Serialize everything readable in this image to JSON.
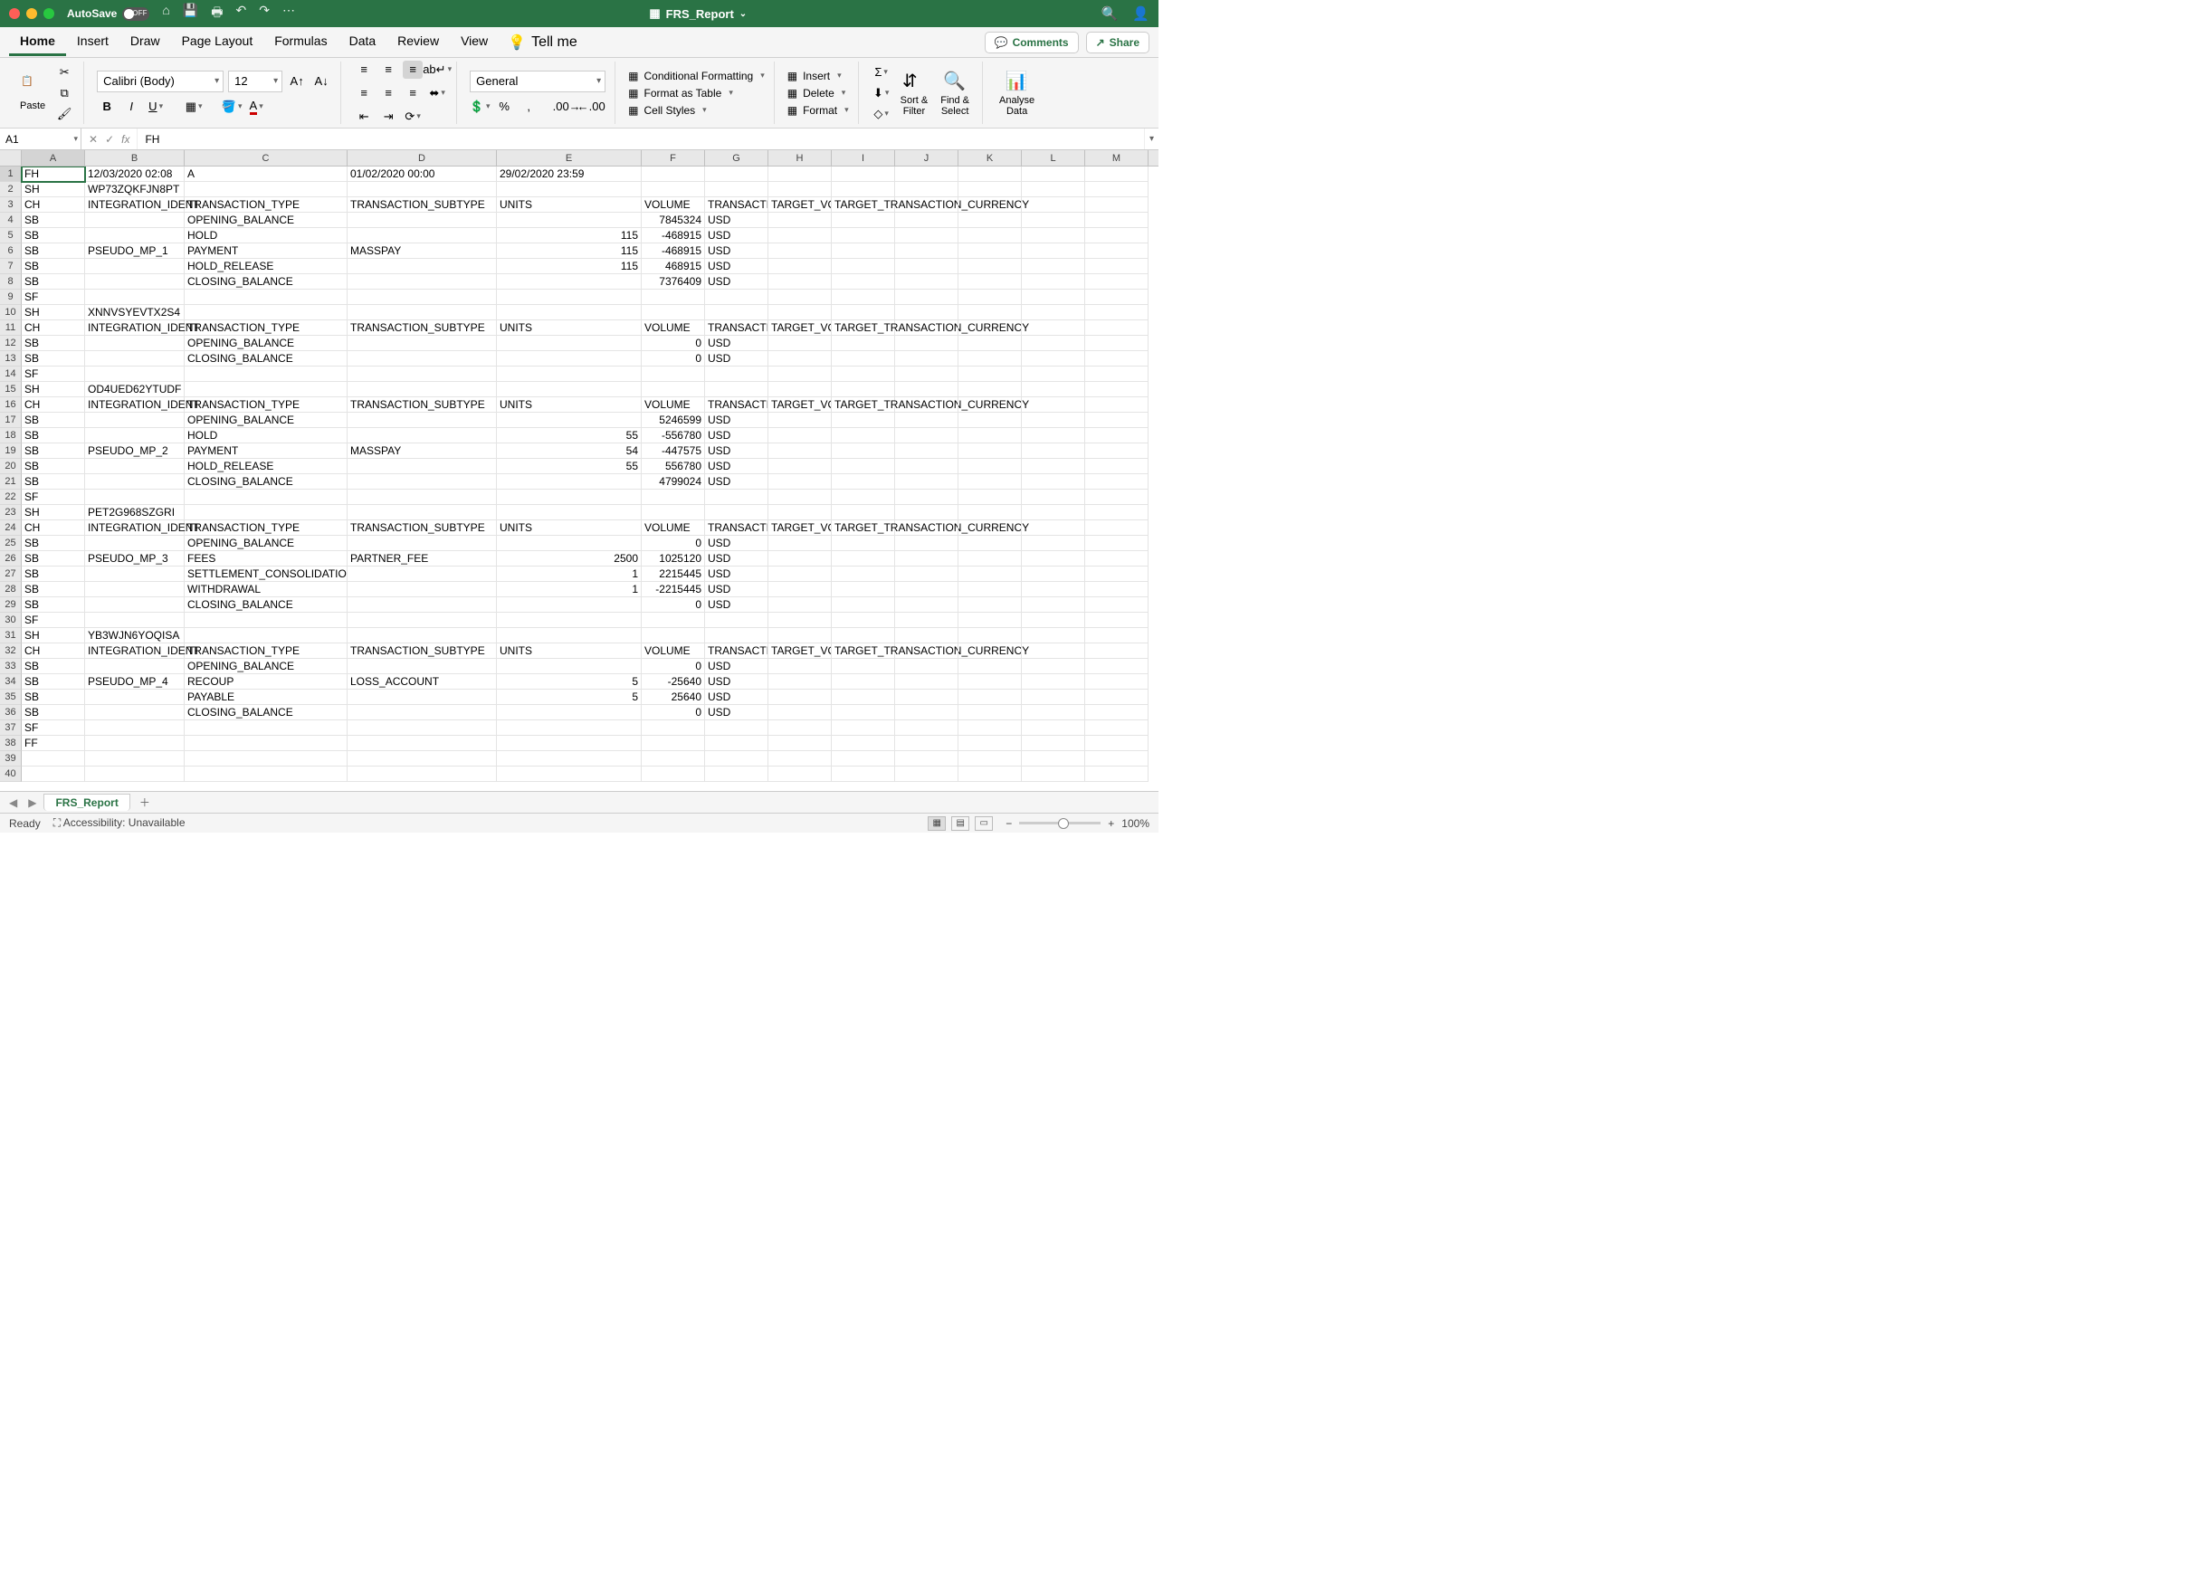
{
  "titlebar": {
    "autosave_label": "AutoSave",
    "autosave_state": "OFF",
    "filename": "FRS_Report"
  },
  "ribbon_tabs": [
    "Home",
    "Insert",
    "Draw",
    "Page Layout",
    "Formulas",
    "Data",
    "Review",
    "View"
  ],
  "tellme": "Tell me",
  "comments_btn": "Comments",
  "share_btn": "Share",
  "ribbon": {
    "paste": "Paste",
    "font_name": "Calibri (Body)",
    "font_size": "12",
    "number_format": "General",
    "cond_fmt": "Conditional Formatting",
    "fmt_table": "Format as Table",
    "cell_styles": "Cell Styles",
    "insert": "Insert",
    "delete": "Delete",
    "format": "Format",
    "sort_filter": "Sort &\nFilter",
    "find_select": "Find &\nSelect",
    "analyse": "Analyse\nData"
  },
  "namebox": "A1",
  "formula": "FH",
  "columns": [
    "A",
    "B",
    "C",
    "D",
    "E",
    "F",
    "G",
    "H",
    "I",
    "J",
    "K",
    "L",
    "M"
  ],
  "col_classes": [
    "cA",
    "cB",
    "cC",
    "cD",
    "cE",
    "cF",
    "cG",
    "cH",
    "cI",
    "cJ",
    "cK",
    "cL",
    "cM"
  ],
  "num_cols": {
    "B": false,
    "E": true,
    "F": true,
    "G": true
  },
  "rows": [
    {
      "n": 1,
      "A": "FH",
      "B": "12/03/2020 02:08",
      "C": "A",
      "D": "01/02/2020 00:00",
      "E": "29/02/2020 23:59"
    },
    {
      "n": 2,
      "A": "SH",
      "B": "WP73ZQKFJN8PT"
    },
    {
      "n": 3,
      "A": "CH",
      "B": "INTEGRATION_IDENT",
      "C": "TRANSACTION_TYPE",
      "D": "TRANSACTION_SUBTYPE",
      "E": "UNITS",
      "F": "VOLUME",
      "G": "TRANSACTIO",
      "H": "TARGET_VO",
      "I": "TARGET_TRANSACTION_CURRENCY"
    },
    {
      "n": 4,
      "A": "SB",
      "C": "OPENING_BALANCE",
      "F": "7845324",
      "G": "USD"
    },
    {
      "n": 5,
      "A": "SB",
      "C": "HOLD",
      "E": "115",
      "F": "-468915",
      "G": "USD"
    },
    {
      "n": 6,
      "A": "SB",
      "B": "PSEUDO_MP_1",
      "C": "PAYMENT",
      "D": "MASSPAY",
      "E": "115",
      "F": "-468915",
      "G": "USD"
    },
    {
      "n": 7,
      "A": "SB",
      "C": "HOLD_RELEASE",
      "E": "115",
      "F": "468915",
      "G": "USD"
    },
    {
      "n": 8,
      "A": "SB",
      "C": "CLOSING_BALANCE",
      "F": "7376409",
      "G": "USD"
    },
    {
      "n": 9,
      "A": "SF"
    },
    {
      "n": 10,
      "A": "SH",
      "B": "XNNVSYEVTX2S4"
    },
    {
      "n": 11,
      "A": "CH",
      "B": "INTEGRATION_IDENT",
      "C": "TRANSACTION_TYPE",
      "D": "TRANSACTION_SUBTYPE",
      "E": "UNITS",
      "F": "VOLUME",
      "G": "TRANSACTIO",
      "H": "TARGET_VO",
      "I": "TARGET_TRANSACTION_CURRENCY"
    },
    {
      "n": 12,
      "A": "SB",
      "C": "OPENING_BALANCE",
      "F": "0",
      "G": "USD"
    },
    {
      "n": 13,
      "A": "SB",
      "C": "CLOSING_BALANCE",
      "F": "0",
      "G": "USD"
    },
    {
      "n": 14,
      "A": "SF"
    },
    {
      "n": 15,
      "A": "SH",
      "B": "OD4UED62YTUDF"
    },
    {
      "n": 16,
      "A": "CH",
      "B": "INTEGRATION_IDENT",
      "C": "TRANSACTION_TYPE",
      "D": "TRANSACTION_SUBTYPE",
      "E": "UNITS",
      "F": "VOLUME",
      "G": "TRANSACTIO",
      "H": "TARGET_VO",
      "I": "TARGET_TRANSACTION_CURRENCY"
    },
    {
      "n": 17,
      "A": "SB",
      "C": "OPENING_BALANCE",
      "F": "5246599",
      "G": "USD"
    },
    {
      "n": 18,
      "A": "SB",
      "C": "HOLD",
      "E": "55",
      "F": "-556780",
      "G": "USD"
    },
    {
      "n": 19,
      "A": "SB",
      "B": "PSEUDO_MP_2",
      "C": "PAYMENT",
      "D": "MASSPAY",
      "E": "54",
      "F": "-447575",
      "G": "USD"
    },
    {
      "n": 20,
      "A": "SB",
      "C": "HOLD_RELEASE",
      "E": "55",
      "F": "556780",
      "G": "USD"
    },
    {
      "n": 21,
      "A": "SB",
      "C": "CLOSING_BALANCE",
      "F": "4799024",
      "G": "USD"
    },
    {
      "n": 22,
      "A": "SF"
    },
    {
      "n": 23,
      "A": "SH",
      "B": "PET2G968SZGRI"
    },
    {
      "n": 24,
      "A": "CH",
      "B": "INTEGRATION_IDENT",
      "C": "TRANSACTION_TYPE",
      "D": "TRANSACTION_SUBTYPE",
      "E": "UNITS",
      "F": "VOLUME",
      "G": "TRANSACTIO",
      "H": "TARGET_VO",
      "I": "TARGET_TRANSACTION_CURRENCY"
    },
    {
      "n": 25,
      "A": "SB",
      "C": "OPENING_BALANCE",
      "F": "0",
      "G": "USD"
    },
    {
      "n": 26,
      "A": "SB",
      "B": "PSEUDO_MP_3",
      "C": "FEES",
      "D": "PARTNER_FEE",
      "E": "2500",
      "F": "1025120",
      "G": "USD"
    },
    {
      "n": 27,
      "A": "SB",
      "C": "SETTLEMENT_CONSOLIDATION",
      "E": "1",
      "F": "2215445",
      "G": "USD"
    },
    {
      "n": 28,
      "A": "SB",
      "C": "WITHDRAWAL",
      "E": "1",
      "F": "-2215445",
      "G": "USD"
    },
    {
      "n": 29,
      "A": "SB",
      "C": "CLOSING_BALANCE",
      "F": "0",
      "G": "USD"
    },
    {
      "n": 30,
      "A": "SF"
    },
    {
      "n": 31,
      "A": "SH",
      "B": "YB3WJN6YOQISA"
    },
    {
      "n": 32,
      "A": "CH",
      "B": "INTEGRATION_IDENT",
      "C": "TRANSACTION_TYPE",
      "D": "TRANSACTION_SUBTYPE",
      "E": "UNITS",
      "F": "VOLUME",
      "G": "TRANSACTIO",
      "H": "TARGET_VO",
      "I": "TARGET_TRANSACTION_CURRENCY"
    },
    {
      "n": 33,
      "A": "SB",
      "C": "OPENING_BALANCE",
      "F": "0",
      "G": "USD"
    },
    {
      "n": 34,
      "A": "SB",
      "B": "PSEUDO_MP_4",
      "C": "RECOUP",
      "D": "LOSS_ACCOUNT",
      "E": "5",
      "F": "-25640",
      "G": "USD"
    },
    {
      "n": 35,
      "A": "SB",
      "C": "PAYABLE",
      "E": "5",
      "F": "25640",
      "G": "USD"
    },
    {
      "n": 36,
      "A": "SB",
      "C": "CLOSING_BALANCE",
      "F": "0",
      "G": "USD"
    },
    {
      "n": 37,
      "A": "SF"
    },
    {
      "n": 38,
      "A": "FF"
    },
    {
      "n": 39
    },
    {
      "n": 40
    }
  ],
  "sheet_tab": "FRS_Report",
  "status": {
    "ready": "Ready",
    "accessibility": "Accessibility: Unavailable",
    "zoom": "100%"
  }
}
